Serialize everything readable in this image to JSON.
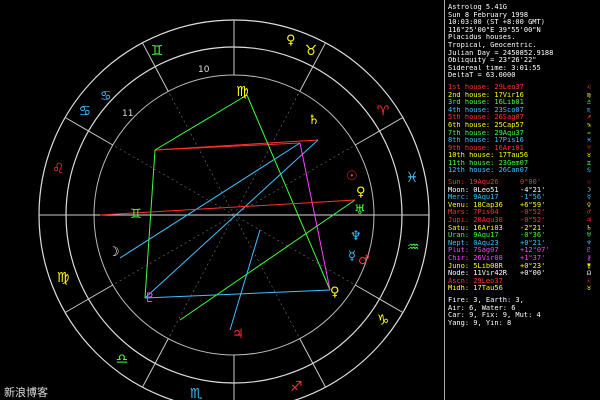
{
  "wheel": {
    "outer_signs": [
      {
        "name": "aries",
        "glyph": "♈",
        "color": "#ff3030",
        "angle": 35
      },
      {
        "name": "taurus",
        "glyph": "♉",
        "color": "#ffff00",
        "angle": 65
      },
      {
        "name": "gemini",
        "glyph": "♊",
        "color": "#40ff40",
        "angle": 115
      },
      {
        "name": "cancer",
        "glyph": "♋",
        "color": "#40c0ff",
        "angle": 145
      },
      {
        "name": "leo",
        "glyph": "♌",
        "color": "#ff3030",
        "angle": 165
      },
      {
        "name": "virgo",
        "glyph": "♍",
        "color": "#ffff00",
        "angle": 200
      },
      {
        "name": "libra",
        "glyph": "♎",
        "color": "#40ff40",
        "angle": 232
      },
      {
        "name": "scorpio",
        "glyph": "♏",
        "color": "#40c0ff",
        "angle": 258
      },
      {
        "name": "sagittarius",
        "glyph": "♐",
        "color": "#ff3030",
        "angle": 290
      },
      {
        "name": "capricorn",
        "glyph": "♑",
        "color": "#ffff00",
        "angle": 325
      },
      {
        "name": "aquarius",
        "glyph": "♒",
        "color": "#40ff40",
        "angle": 350
      },
      {
        "name": "pisces",
        "glyph": "♓",
        "color": "#40c0ff",
        "angle": 12
      }
    ],
    "house_numbers": [
      "10",
      "11"
    ],
    "center_glyphs": {
      "virgo_mc": "♍"
    }
  },
  "info": {
    "title": "Astrolog 5.41G",
    "date": "Sun 8 February 1998",
    "time": "10:03:00 (ST +8:00 GMT)",
    "location": "116°25'00\"E 39°55'00\"N",
    "system1": "Placidus houses.",
    "system2": "Tropical, Geocentric.",
    "julian": "Julian Day = 2450852.9188",
    "obliquity": "Obliquity = 23°26'22\"",
    "sidereal": "Sidereal time: 3:01:55",
    "delta": "DeltaT = 63.0000"
  },
  "houses": [
    {
      "label": "1st house:",
      "value": "29Leo37",
      "color": "#ff3030",
      "glyph": "♌"
    },
    {
      "label": "2nd house:",
      "value": "17Vir16",
      "color": "#ffff00",
      "glyph": "♍"
    },
    {
      "label": "3rd house:",
      "value": "16Lib01",
      "color": "#40ff40",
      "glyph": "♎"
    },
    {
      "label": "4th house:",
      "value": "23Sco07",
      "color": "#40c0ff",
      "glyph": "♏"
    },
    {
      "label": "5th house:",
      "value": "26Sag07",
      "color": "#ff3030",
      "glyph": "♐"
    },
    {
      "label": "6th house:",
      "value": "25Cap57",
      "color": "#ffff00",
      "glyph": "♑"
    },
    {
      "label": "7th house:",
      "value": "29Aqu37",
      "color": "#40ff40",
      "glyph": "♒"
    },
    {
      "label": "8th house:",
      "value": "17Pis16",
      "color": "#40c0ff",
      "glyph": "♓"
    },
    {
      "label": "9th house:",
      "value": "16Ari01",
      "color": "#ff3030",
      "glyph": "♈"
    },
    {
      "label": "10th house:",
      "value": "17Tau56",
      "color": "#ffff00",
      "glyph": "♉"
    },
    {
      "label": "11th house:",
      "value": "23Gem07",
      "color": "#40ff40",
      "glyph": "♊"
    },
    {
      "label": "12th house:",
      "value": "26Can07",
      "color": "#40c0ff",
      "glyph": "♋"
    }
  ],
  "planets": [
    {
      "label": "Sun:",
      "value": "19Aqu26",
      "lat": "0°00'",
      "color": "#ff3030",
      "glyph": "☉"
    },
    {
      "label": "Moon:",
      "value": "0Leo51",
      "lat": "-4°21'",
      "color": "#ffffff",
      "glyph": "☽"
    },
    {
      "label": "Merc:",
      "value": "9Aqu17",
      "lat": "-1°56'",
      "color": "#40c0ff",
      "glyph": "☿"
    },
    {
      "label": "Venu:",
      "value": "18Cap36",
      "lat": "+6°59'",
      "color": "#ffff00",
      "glyph": "♀"
    },
    {
      "label": "Mars:",
      "value": "7Pis04",
      "lat": "-0°52'",
      "color": "#ff3030",
      "glyph": "♂"
    },
    {
      "label": "Jupi:",
      "value": "20Aqu30",
      "lat": "-0°52'",
      "color": "#ff3030",
      "glyph": "♃"
    },
    {
      "label": "Satu:",
      "value": "16Ari03",
      "lat": "-2°21'",
      "color": "#ffff00",
      "glyph": "♄"
    },
    {
      "label": "Uran:",
      "value": "9Aqu17",
      "lat": "-0°36'",
      "color": "#40ff40",
      "glyph": "♅"
    },
    {
      "label": "Nept:",
      "value": "0Aqu23",
      "lat": "+0°21'",
      "color": "#40c0ff",
      "glyph": "♆"
    },
    {
      "label": "Plut:",
      "value": "7Sag07",
      "lat": "+12°07'",
      "color": "#ff40ff",
      "glyph": "♇"
    },
    {
      "label": "Chir:",
      "value": "26Vir08",
      "lat": "+1°37'",
      "color": "#ff40ff",
      "glyph": "⚷"
    },
    {
      "label": "Juno:",
      "value": "5Lib08R",
      "lat": "+0°23'",
      "color": "#ffff00",
      "glyph": "⚵"
    },
    {
      "label": "Node:",
      "value": "11Vir42R",
      "lat": "+0°00'",
      "color": "#ffffff",
      "glyph": "☊"
    },
    {
      "label": "Ascn:",
      "value": "29Leo37",
      "lat": "",
      "color": "#ff3030",
      "glyph": "♌"
    },
    {
      "label": "Midh:",
      "value": "17Tau56",
      "lat": "",
      "color": "#ffff00",
      "glyph": "♉"
    }
  ],
  "elements": [
    "Fire: 3, Earth: 3,",
    "Air: 6, Water: 6",
    "Car: 9, Fix: 9, Mut: 4",
    "Yang: 9, Yin: 8"
  ],
  "watermark": "新浪博客"
}
